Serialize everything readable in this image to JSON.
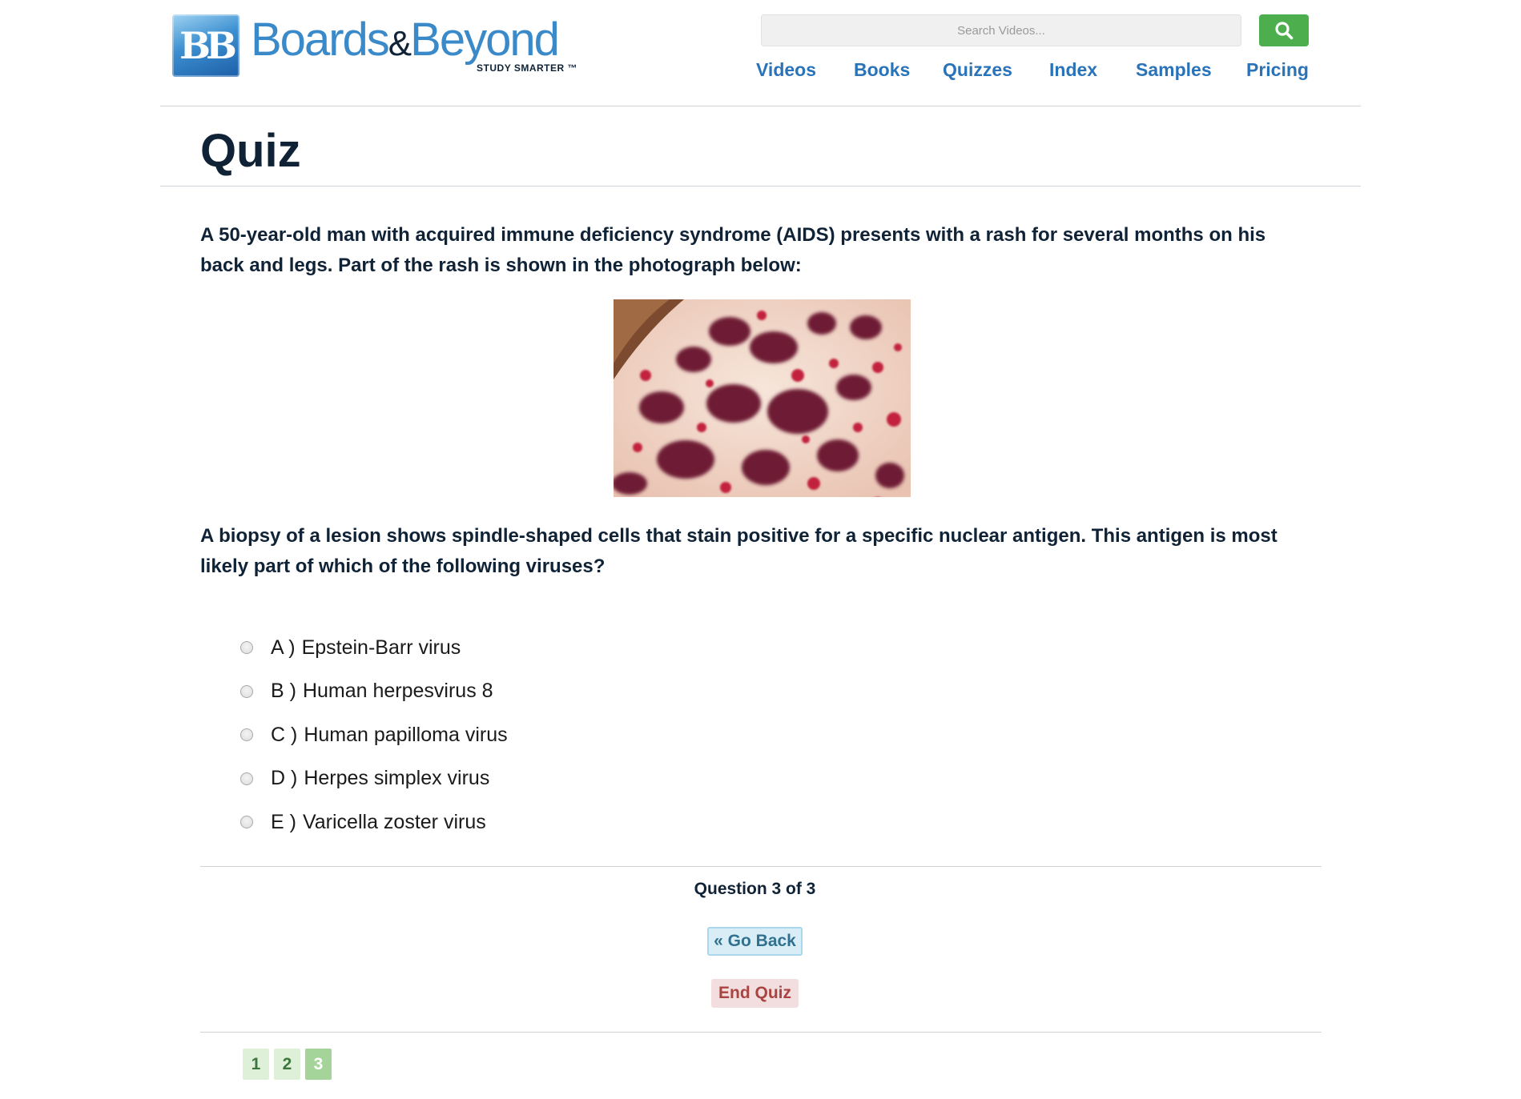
{
  "header": {
    "logo_mark": "BB",
    "logo_name_part1": "Boards",
    "logo_amp": "&",
    "logo_name_part2": "Beyond",
    "logo_tagline": "STUDY SMARTER ™",
    "search_placeholder": "Search Videos...",
    "nav": [
      "Videos",
      "Books",
      "Quizzes",
      "Index",
      "Samples",
      "Pricing"
    ],
    "colors": {
      "nav": "#2a73b8",
      "search_button": "#4cae4c"
    }
  },
  "page_title": "Quiz",
  "question": {
    "stem": "A 50-year-old man with acquired immune deficiency syndrome (AIDS) presents with a rash for several months on his back and legs. Part of the rash is shown in the photograph below:",
    "followup": "A biopsy of a lesion shows spindle-shaped cells that stain positive for a specific nuclear antigen. This antigen is most likely part of which of the following viruses?",
    "options": [
      {
        "letter": "A )",
        "text": "Epstein-Barr virus"
      },
      {
        "letter": "B )",
        "text": "Human herpesvirus 8"
      },
      {
        "letter": "C )",
        "text": "Human papilloma virus"
      },
      {
        "letter": "D )",
        "text": "Herpes simplex virus"
      },
      {
        "letter": "E )",
        "text": "Varicella zoster virus"
      }
    ]
  },
  "footer": {
    "counter": "Question 3 of 3",
    "go_back": "« Go Back",
    "end_quiz": "End Quiz",
    "pages": [
      "1",
      "2",
      "3"
    ],
    "current_page": "3"
  }
}
